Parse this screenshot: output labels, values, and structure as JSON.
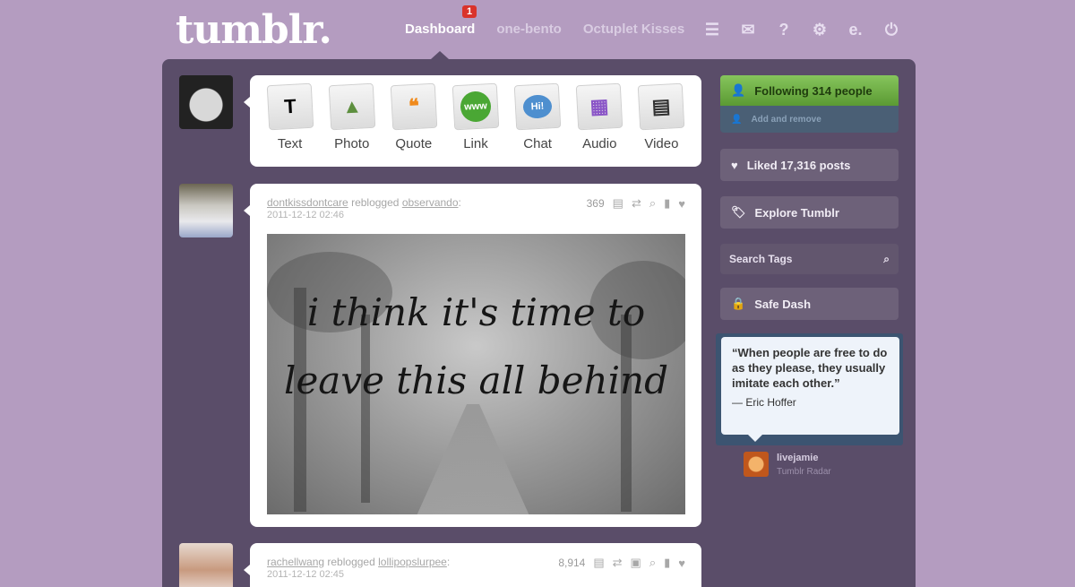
{
  "header": {
    "logo": "tumblr.",
    "nav": [
      {
        "label": "Dashboard",
        "active": true,
        "badge": "1"
      },
      {
        "label": "one-bento"
      },
      {
        "label": "Octuplet Kisses"
      }
    ],
    "icons": [
      "list-icon",
      "mail-icon",
      "help-icon",
      "gear-icon",
      "e-icon",
      "power-icon"
    ]
  },
  "post_types": [
    {
      "label": "Text",
      "icon": "T"
    },
    {
      "label": "Photo",
      "icon": "▲"
    },
    {
      "label": "Quote",
      "icon": "❝"
    },
    {
      "label": "Link",
      "icon": "www"
    },
    {
      "label": "Chat",
      "icon": "Hi!"
    },
    {
      "label": "Audio",
      "icon": "▦"
    },
    {
      "label": "Video",
      "icon": "▤"
    }
  ],
  "posts": [
    {
      "user": "dontkissdontcare",
      "action": "reblogged",
      "source": "observando",
      "date": "2011-12-12 02:46",
      "notes": "369",
      "photo_text": "i think it's time to leave this all behind"
    },
    {
      "user": "rachellwang",
      "action": "reblogged",
      "source": "lollipopslurpee",
      "date": "2011-12-12 02:45",
      "notes": "8,914"
    }
  ],
  "sidebar": {
    "following": "Following 314 people",
    "add_remove": "Add and remove",
    "liked": "Liked 17,316 posts",
    "explore": "Explore Tumblr",
    "search_placeholder": "Search Tags",
    "safe_dash": "Safe Dash",
    "radar": {
      "quote": "“When people are free to do as they please, they usually imitate each other.”",
      "author": "— Eric Hoffer",
      "user": "livejamie",
      "label": "Tumblr Radar"
    }
  }
}
